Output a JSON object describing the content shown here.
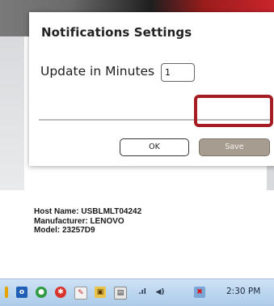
{
  "dialog": {
    "title": "Notifications Settings",
    "update_label": "Update in Minutes",
    "minutes_value": "1",
    "ok_label": "OK",
    "save_label": "Save"
  },
  "device": {
    "host_name": "Host Name: USBLMLT04242",
    "manufacturer": "Manufacturer: LENOVO",
    "model": "Model: 23257D9"
  },
  "taskbar": {
    "icons": [
      "outlook-icon",
      "chrome-icon",
      "antivirus-icon",
      "paint-icon",
      "lock-icon",
      "clipboard-icon",
      "signal-icon",
      "volume-icon",
      "network-error-icon"
    ],
    "clock": "2:30 PM"
  },
  "colors": {
    "highlight": "#a51c22",
    "save_button": "#a79c90",
    "taskbar": "#bcd6ef"
  }
}
